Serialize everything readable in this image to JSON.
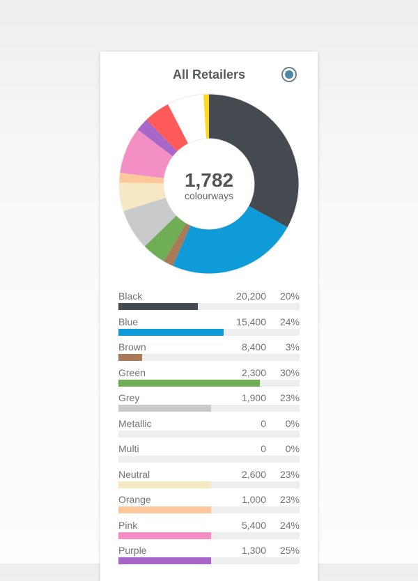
{
  "card": {
    "title": "All Retailers"
  },
  "chart_data": {
    "type": "pie",
    "title": "All Retailers",
    "center": {
      "total": "1,782",
      "unit": "colourways"
    },
    "slices": [
      {
        "label": "Black",
        "share": 33.6,
        "color": "#454950"
      },
      {
        "label": "Blue",
        "share": 24.0,
        "color": "#0f9bd8"
      },
      {
        "label": "Brown",
        "share": 1.8,
        "color": "#a97a58"
      },
      {
        "label": "Green",
        "share": 4.4,
        "color": "#6fae55"
      },
      {
        "label": "Grey",
        "share": 7.5,
        "color": "#c9cacc"
      },
      {
        "label": "Neutral",
        "share": 5.2,
        "color": "#f5e8c2"
      },
      {
        "label": "Orange",
        "share": 1.8,
        "color": "#ffc89b"
      },
      {
        "label": "Pink",
        "share": 8.5,
        "color": "#f48fc6"
      },
      {
        "label": "Purple",
        "share": 2.4,
        "color": "#a966c9"
      },
      {
        "label": "Red",
        "share": 4.8,
        "color": "#ff5a5a"
      },
      {
        "label": "White",
        "share": 6.7,
        "color": "#ffffff"
      },
      {
        "label": "Yellow",
        "share": 1.0,
        "color": "#ffd91f"
      }
    ],
    "legend": [
      {
        "label": "Black",
        "value": "20,200",
        "pct": "20%",
        "bar_fraction": 0.44,
        "color": "#454950"
      },
      {
        "label": "Blue",
        "value": "15,400",
        "pct": "24%",
        "bar_fraction": 0.58,
        "color": "#0f9bd8"
      },
      {
        "label": "Brown",
        "value": "8,400",
        "pct": "3%",
        "bar_fraction": 0.13,
        "color": "#a97a58"
      },
      {
        "label": "Green",
        "value": "2,300",
        "pct": "30%",
        "bar_fraction": 0.78,
        "color": "#6fae55"
      },
      {
        "label": "Grey",
        "value": "1,900",
        "pct": "23%",
        "bar_fraction": 0.51,
        "color": "#c9cacc"
      },
      {
        "label": "Metallic",
        "value": "0",
        "pct": "0%",
        "bar_fraction": 0.0,
        "color": "#b0b0b0"
      },
      {
        "label": "Multi",
        "value": "0",
        "pct": "0%",
        "bar_fraction": 0.0,
        "color": "#b0b0b0"
      },
      {
        "label": "Neutral",
        "value": "2,600",
        "pct": "23%",
        "bar_fraction": 0.51,
        "color": "#f5e8c2"
      },
      {
        "label": "Orange",
        "value": "1,000",
        "pct": "23%",
        "bar_fraction": 0.51,
        "color": "#ffc89b"
      },
      {
        "label": "Pink",
        "value": "5,400",
        "pct": "24%",
        "bar_fraction": 0.51,
        "color": "#f48fc6"
      },
      {
        "label": "Purple",
        "value": "1,300",
        "pct": "25%",
        "bar_fraction": 0.51,
        "color": "#a966c9"
      }
    ]
  },
  "icons": {
    "toggle": "radio-toggle-icon"
  }
}
